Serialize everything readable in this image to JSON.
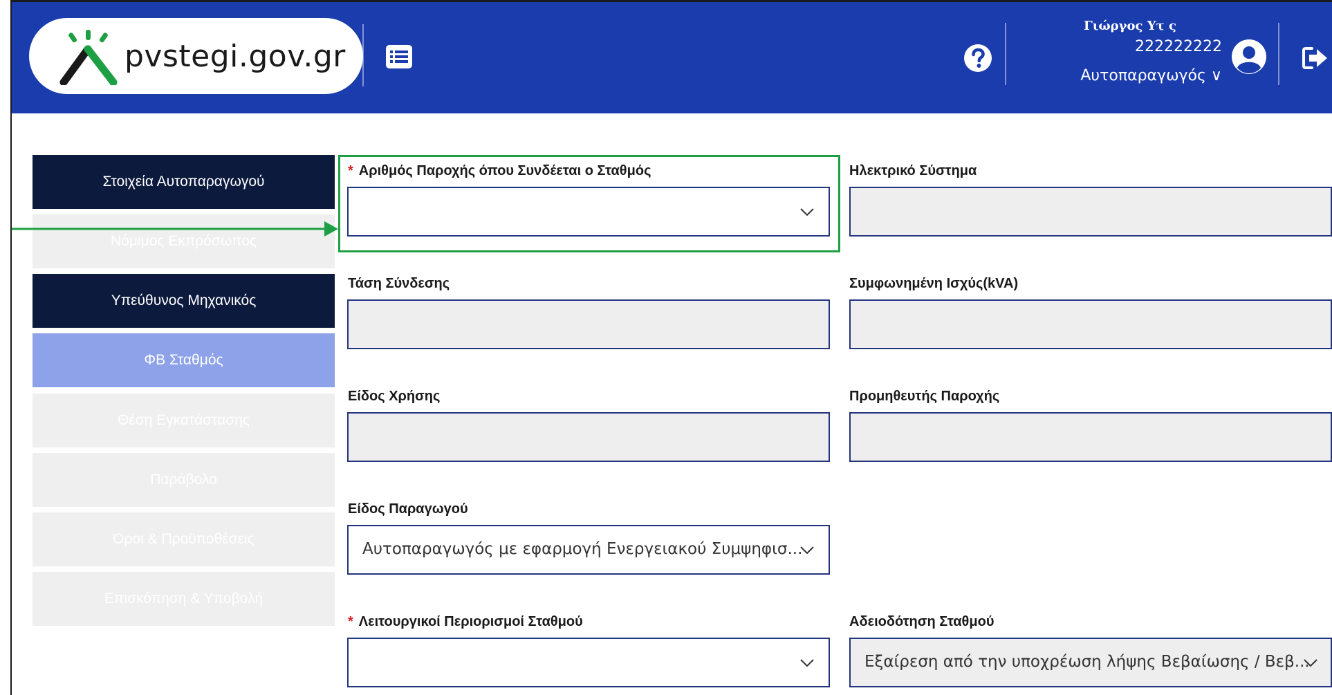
{
  "header": {
    "logo_text": "pvstegi.gov.gr",
    "user": {
      "name": "Γιώργος Υτ           ς",
      "id": "222222222",
      "role": "Αυτοπαραγωγός ∨"
    },
    "colors": {
      "header_bg": "#1a3cad",
      "accent_green": "#1da043"
    },
    "icons": [
      "menu-list-icon",
      "help-icon",
      "user-avatar-icon",
      "logout-icon"
    ]
  },
  "sidebar": {
    "items": [
      {
        "label": "Στοιχεία Αυτοπαραγωγού",
        "state": "completed"
      },
      {
        "label": "Νόμιμος Εκπρόσωπος",
        "state": "disabled"
      },
      {
        "label": "Υπεύθυνος Μηχανικός",
        "state": "completed"
      },
      {
        "label": "ΦΒ Σταθμός",
        "state": "active"
      },
      {
        "label": "Θέση Εγκατάστασης",
        "state": "disabled"
      },
      {
        "label": "Παράβολο",
        "state": "disabled"
      },
      {
        "label": "Όροι & Προϋποθέσεις",
        "state": "disabled"
      },
      {
        "label": "Επισκόπηση & Υποβολή",
        "state": "disabled"
      }
    ]
  },
  "form": {
    "supply_number": {
      "label": "Αριθμός Παροχής όπου Συνδέεται ο Σταθμός",
      "required": "*",
      "value": ""
    },
    "electric_system": {
      "label": "Ηλεκτρικό Σύστημα",
      "value": ""
    },
    "connection_voltage": {
      "label": "Τάση Σύνδεσης",
      "value": ""
    },
    "agreed_power": {
      "label": "Συμφωνημένη Ισχύς(kVA)",
      "value": ""
    },
    "usage_type": {
      "label": "Είδος Χρήσης",
      "value": ""
    },
    "supply_provider": {
      "label": "Προμηθευτής Παροχής",
      "value": ""
    },
    "producer_type": {
      "label": "Είδος Παραγωγού",
      "value": "Αυτοπαραγωγός με εφαρμογή Ενεργειακού Συμψηφισ..."
    },
    "operational_limits": {
      "label": "Λειτουργικοί Περιορισμοί Σταθμού",
      "required": "*",
      "value": ""
    },
    "station_licensing": {
      "label": "Αδειοδότηση Σταθμού",
      "value": "Εξαίρεση από την υποχρέωση λήψης Βεβαίωσης / Βεβ..."
    }
  }
}
